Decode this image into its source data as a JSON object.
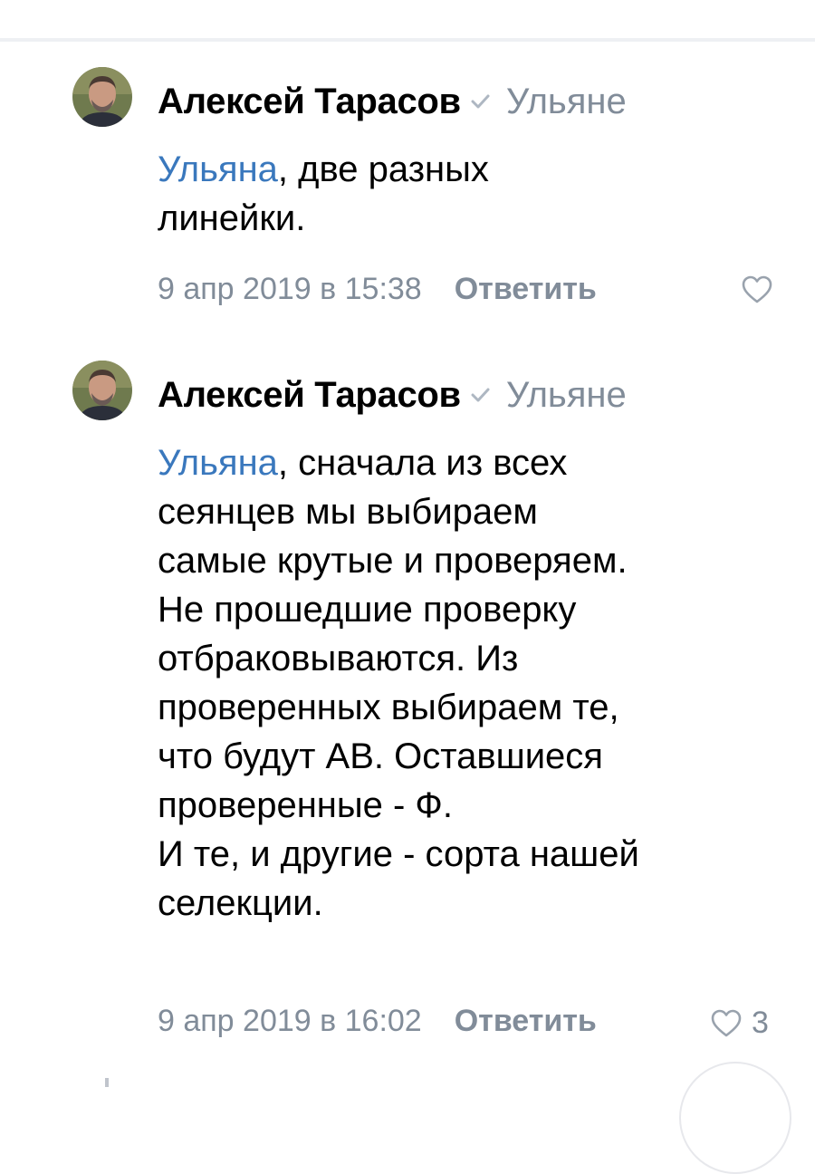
{
  "comments": [
    {
      "author": "Алексей Тарасов",
      "verified_icon": "check-icon",
      "reply_to": "Ульяне",
      "mention": "Ульяна",
      "text": ", две разных\nлинейки.",
      "date": "9 апр 2019 в 15:38",
      "reply_label": "Ответить",
      "like_icon": "heart-outline-icon",
      "likes": ""
    },
    {
      "author": "Алексей Тарасов",
      "verified_icon": "check-icon",
      "reply_to": "Ульяне",
      "mention": "Ульяна",
      "text": ", сначала из всех\nсеянцев мы выбираем\nсамые крутые и проверяем.\nНе прошедшие проверку\nотбраковываются. Из\nпроверенных выбираем те,\nчто будут АВ. Оставшиеся\nпроверенные - Ф.\nИ те, и другие - сорта нашей\nселекции.",
      "date": "9 апр 2019 в 16:02",
      "reply_label": "Ответить",
      "like_icon": "heart-outline-icon",
      "likes": "3"
    }
  ],
  "colors": {
    "link": "#3a78bd",
    "secondary": "#818c99",
    "divider": "#eef0f3"
  }
}
